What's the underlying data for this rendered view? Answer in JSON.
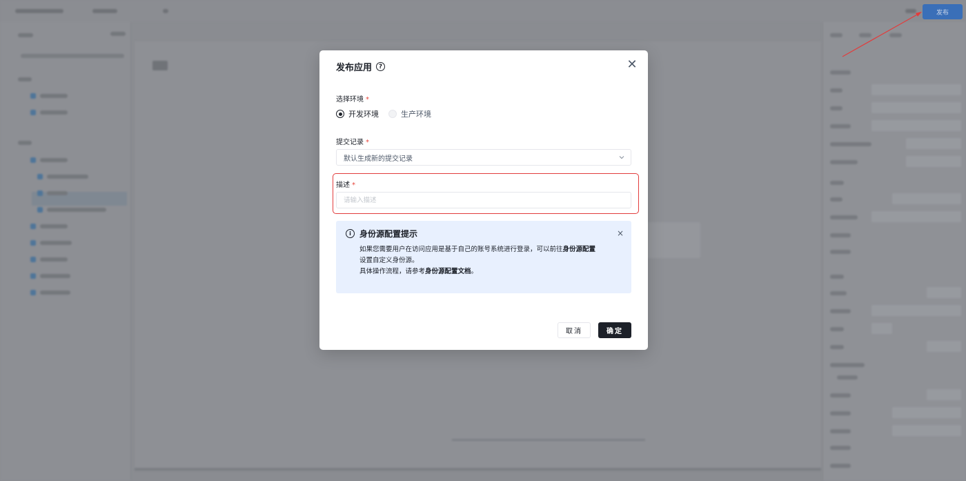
{
  "app": {
    "publish_button_label": "发布",
    "arrow_color": "#e23c3c"
  },
  "modal": {
    "title": "发布应用",
    "help_icon": "question-circle-icon",
    "close_icon": "close-icon",
    "environment": {
      "label": "选择环境",
      "required_mark": "*",
      "options": [
        {
          "label": "开发环境",
          "checked": true
        },
        {
          "label": "生产环境",
          "checked": false
        }
      ]
    },
    "commit": {
      "label": "提交记录",
      "required_mark": "*",
      "selected": "默认生成新的提交记录"
    },
    "description": {
      "label": "描述",
      "required_mark": "*",
      "value": "",
      "placeholder": "请输入描述"
    },
    "tip": {
      "icon": "info-circle-icon",
      "title": "身份源配置提示",
      "line1_pre": "如果您需要用户在访问应用是基于自己的账号系统进行登录，可以前往",
      "line1_bold": "身份源配置",
      "line2": "设置自定义身份源。",
      "line3_pre": "具体操作流程，请参考",
      "line3_bold": "身份源配置文档",
      "line3_post": "。",
      "close": "×"
    },
    "buttons": {
      "cancel": "取消",
      "ok": "确定"
    },
    "highlight_color": "#e23c3c"
  }
}
